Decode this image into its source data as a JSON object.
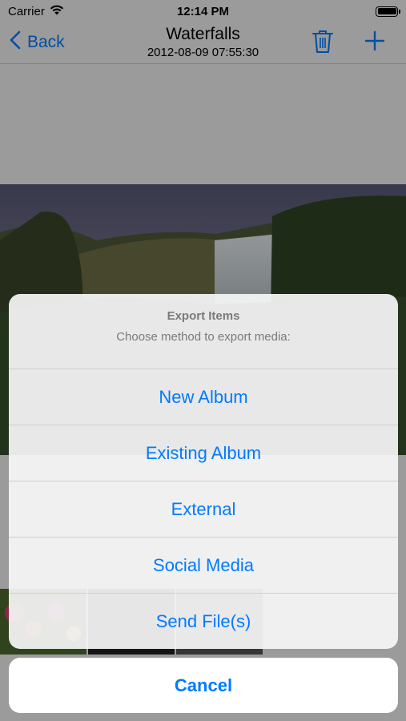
{
  "status_bar": {
    "carrier": "Carrier",
    "time": "12:14 PM"
  },
  "nav": {
    "back_label": "Back",
    "title": "Waterfalls",
    "subtitle": "2012-08-09 07:55:30"
  },
  "icons": {
    "back": "chevron-left-icon",
    "trash": "trash-icon",
    "add": "plus-icon",
    "wifi": "wifi-icon",
    "battery": "battery-icon"
  },
  "action_sheet": {
    "title": "Export Items",
    "message": "Choose method to export media:",
    "actions": [
      {
        "label": "New Album"
      },
      {
        "label": "Existing Album"
      },
      {
        "label": "External"
      },
      {
        "label": "Social Media"
      },
      {
        "label": "Send File(s)"
      }
    ],
    "cancel_label": "Cancel"
  },
  "colors": {
    "accent": "#007aff",
    "sheet_bg": "#f6f6f6",
    "header_text": "#7a7a7a",
    "dim_overlay": "rgba(0,0,0,0.36)"
  }
}
